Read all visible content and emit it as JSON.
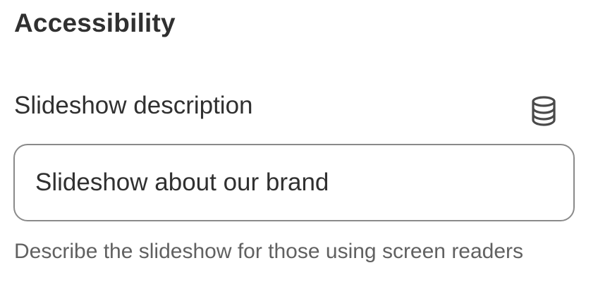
{
  "section": {
    "title": "Accessibility"
  },
  "field": {
    "label": "Slideshow description",
    "value": "Slideshow about our brand",
    "help_text": "Describe the slideshow for those using screen readers",
    "icon": "database-icon"
  }
}
